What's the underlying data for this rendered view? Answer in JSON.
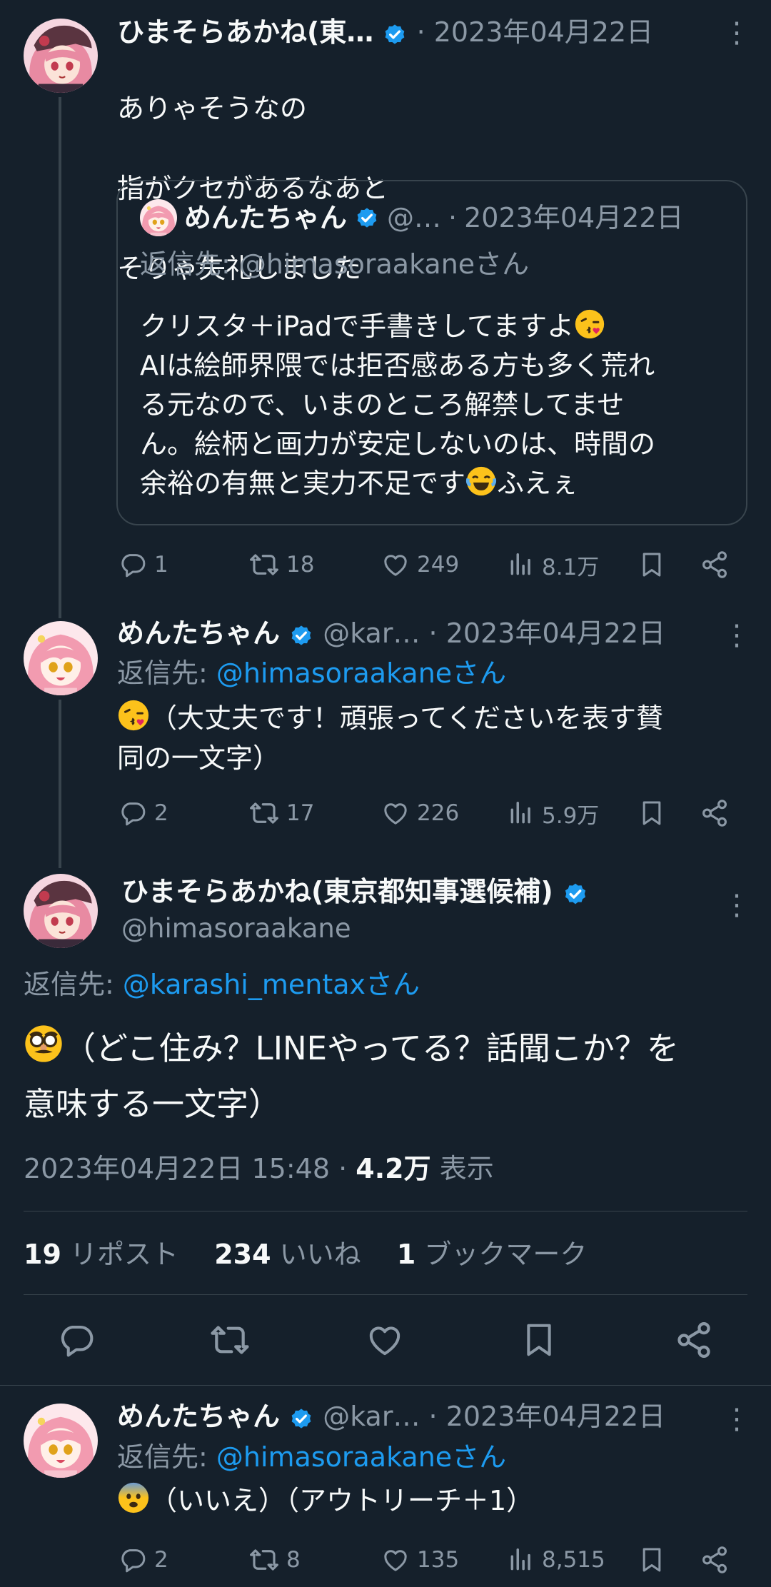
{
  "colors": {
    "background": "#15202b",
    "text": "#f7f9f9",
    "muted": "#8b98a5",
    "accent": "#1d9bf0",
    "border": "#38444d"
  },
  "tweet1": {
    "name": "ひまそらあかね(東…",
    "sep": "·",
    "date": "2023年04月22日",
    "lines": [
      "ありゃそうなの",
      "指がクセがあるなあと",
      "そりゃ失礼しました"
    ],
    "quote": {
      "name": "めんたちゃん",
      "handle": "@…",
      "sep": "·",
      "date": "2023年04月22日",
      "reply_to": "返信先: @himasoraakaneさん",
      "lines": [
        "クリスタ＋iPadで手書きしてますよ",
        "AIは絵師界隈では拒否感ある方も多く荒れ",
        "る元なので、いまのところ解禁してませ",
        "ん。絵柄と画力が安定しないのは、時間の",
        "余裕の有無と実力不足です"
      ],
      "tail": "ふえぇ",
      "emoji1": "kissing-face-emoji",
      "emoji2": "tears-of-joy-emoji"
    },
    "stats": {
      "replies": "1",
      "reposts": "18",
      "likes": "249",
      "views": "8.1万"
    }
  },
  "tweet2": {
    "name": "めんたちゃん",
    "handle": "@kar…",
    "sep": "·",
    "date": "2023年04月22日",
    "reply_prefix": "返信先: ",
    "reply_handle": "@himasoraakaneさん",
    "line1": "（大丈夫です！頑張ってくださいを表す賛",
    "line2": "同の一文字）",
    "emoji": "kissing-face-emoji",
    "stats": {
      "replies": "2",
      "reposts": "17",
      "likes": "226",
      "views": "5.9万"
    }
  },
  "main": {
    "name": "ひまそらあかね(東京都知事選候補)",
    "handle": "@himasoraakane",
    "reply_prefix": "返信先: ",
    "reply_handle": "@karashi_mentaxさん",
    "line1": "（どこ住み？LINEやってる？話聞こか？を",
    "line2": "意味する一文字）",
    "emoji": "disguised-face-emoji",
    "timestamp": "2023年04月22日 15:48",
    "sep": "·",
    "views_count": "4.2万",
    "views_label": "表示",
    "reposts_count": "19",
    "reposts_label": "リポスト",
    "likes_count": "234",
    "likes_label": "いいね",
    "bookmarks_count": "1",
    "bookmarks_label": "ブックマーク"
  },
  "tweet4": {
    "name": "めんたちゃん",
    "handle": "@kar…",
    "sep": "·",
    "date": "2023年04月22日",
    "reply_prefix": "返信先: ",
    "reply_handle": "@himasoraakaneさん",
    "line1": "（いいえ）（アウトリーチ＋1）",
    "emoji": "fearful-face-emoji",
    "stats": {
      "replies": "2",
      "reposts": "8",
      "likes": "135",
      "views": "8,515"
    }
  }
}
